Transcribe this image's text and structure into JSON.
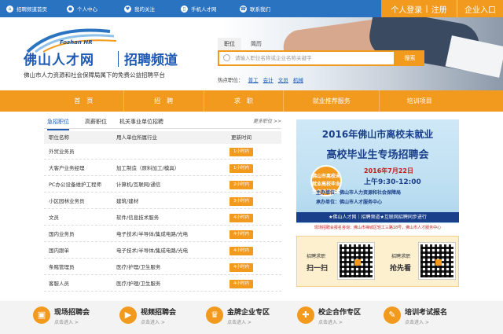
{
  "topbar": {
    "items": [
      {
        "icon": "home-icon",
        "label": "招聘频道首页"
      },
      {
        "icon": "user-icon",
        "label": "个人中心"
      },
      {
        "icon": "heart-icon",
        "label": "我的关注"
      },
      {
        "icon": "mobile-icon",
        "label": "手机人才网"
      },
      {
        "icon": "phone-icon",
        "label": "联系我们"
      }
    ],
    "login_label": "个人登录",
    "register_label": "注册",
    "company_label": "企业入口"
  },
  "brand": {
    "logo_en": "Foshan HR",
    "logo_main": "佛山人才网",
    "logo_channel": "招聘频道",
    "slogan": "佛山市人力资源和社会保障局属下的免费公益招聘平台"
  },
  "search": {
    "tabs": [
      "职位",
      "简历"
    ],
    "placeholder": "请输入职位名称或企业名称关键字",
    "button_label": "搜索",
    "hot_label": "热点职位：",
    "hot_items": [
      "普工",
      "会计",
      "文员",
      "机械"
    ]
  },
  "nav": {
    "items": [
      "首　页",
      "招　聘",
      "求　职",
      "就业推荐服务",
      "培训项目"
    ]
  },
  "jobs": {
    "tabs": [
      "急招职位",
      "高薪职位",
      "机关事业单位招聘"
    ],
    "more_label": "更多职位 >>",
    "headers": [
      "职位名称",
      "用人单位所属行业",
      "更新时间"
    ],
    "rows": [
      {
        "title": "外贸业务员",
        "industry": "",
        "time": "1小时内"
      },
      {
        "title": "大客户业务经理",
        "industry": "加工制造（原料加工/模具）",
        "time": "1小时内"
      },
      {
        "title": "PC办公设备维护工程师",
        "industry": "计算机/互联网/通信",
        "time": "2小时内"
      },
      {
        "title": "小区园林业务员",
        "industry": "建筑/建材",
        "time": "3小时内"
      },
      {
        "title": "文员",
        "industry": "软件/信息技术服务",
        "time": "4小时内"
      },
      {
        "title": "国内业务员",
        "industry": "电子技术/半导体/集成电路/光电",
        "time": "4小时内"
      },
      {
        "title": "国内跟单",
        "industry": "电子技术/半导体/集成电路/光电",
        "time": "4小时内"
      },
      {
        "title": "条赌管理员",
        "industry": "医疗/护理/卫生服务",
        "time": "4小时内"
      },
      {
        "title": "客服人员",
        "industry": "医疗/护理/卫生服务",
        "time": "4小时内"
      }
    ]
  },
  "banner": {
    "title1": "2016年佛山市离校未就业",
    "title2": "高校毕业生专场招聘会",
    "badge": "佛山市离校未就业高校毕业生专场招聘会",
    "date": "2016年7月22日",
    "time": "上午9:30-12:00",
    "line1": "主办单位：佛山市人力资源和社会保障局",
    "line2": "承办单位：佛山市人才服务中心",
    "strip": "★佛山人才网｜招聘频道★互联网招聘同步进行",
    "footer": "现场招聘会报名咨询：佛山市禅城区轻工三路18号，佛山市人才服务中心"
  },
  "qr": {
    "left_title": "招聘求职",
    "left_big": "扫一扫",
    "right_title": "招聘求职",
    "right_big": "抢先看"
  },
  "bottom": {
    "items": [
      {
        "icon": "screen-icon",
        "title": "现场招聘会",
        "sub": "点击进入 >"
      },
      {
        "icon": "video-icon",
        "title": "视频招聘会",
        "sub": "点击进入 >"
      },
      {
        "icon": "crown-icon",
        "title": "金牌企业专区",
        "sub": "点击进入 >"
      },
      {
        "icon": "handshake-icon",
        "title": "校企合作专区",
        "sub": "点击进入 >"
      },
      {
        "icon": "book-icon",
        "title": "培训考试报名",
        "sub": "点击进入 >"
      }
    ]
  },
  "colors": {
    "primary_blue": "#2a73c0",
    "accent_orange": "#f29a1e",
    "logo_blue": "#1e5ab3"
  }
}
